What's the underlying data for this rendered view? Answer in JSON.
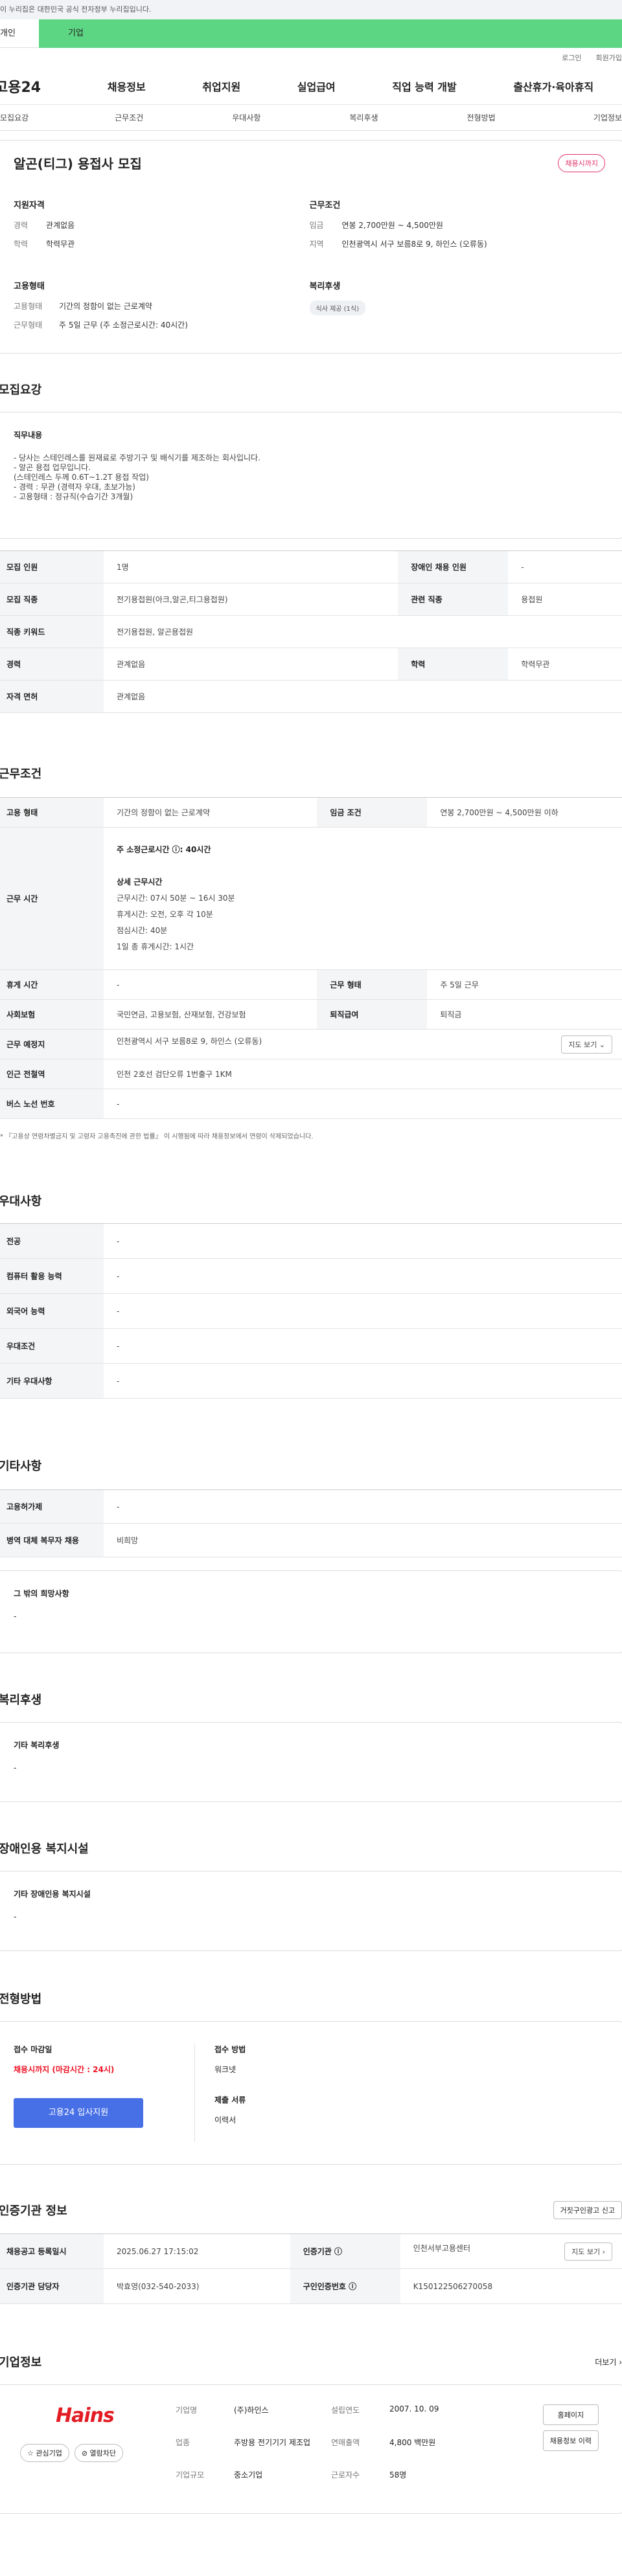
{
  "gov_banner": "이 누리집은 대한민국 공식 전자정부 누리집입니다.",
  "topbar": {
    "t1": "개인",
    "t2": "기업"
  },
  "util": [
    "로그인",
    "회원가입"
  ],
  "logo": "고용24",
  "gnb": [
    "채용정보",
    "취업지원",
    "실업급여",
    "직업 능력 개발",
    "출산휴가·육아휴직"
  ],
  "subtabs": [
    "모집요강",
    "근무조건",
    "우대사항",
    "복리후생",
    "전형방법",
    "기업정보"
  ],
  "summary": {
    "title": "알곤(티그) 용접사 모집",
    "badge": "채용시까지",
    "qual_h": "지원자격",
    "qual": [
      {
        "k": "경력",
        "v": "관계없음"
      },
      {
        "k": "학력",
        "v": "학력무관"
      }
    ],
    "cond_h": "근무조건",
    "cond": [
      {
        "k": "임금",
        "v": "연봉 2,700만원 ~ 4,500만원"
      },
      {
        "k": "지역",
        "v": "인천광역시 서구 보름8로 9, 하인스 (오류동)"
      }
    ],
    "emp_h": "고용형태",
    "emp": [
      {
        "k": "고용형태",
        "v": "기간의 정함이 없는 근로계약"
      },
      {
        "k": "근무형태",
        "v": "주 5일 근무 (주 소정근로시간: 40시간)"
      }
    ],
    "welf_h": "복리후생",
    "welf_chip": "식사 제공 (1식)"
  },
  "recruit": {
    "title": "모집요강",
    "job_h": "직무내용",
    "desc": [
      "- 당사는 스테인레스를 원재료로 주방기구 및 배식기를 제조하는 회사입니다.",
      "- 알곤 용접 업무입니다.",
      "  (스테인레스 두께 0.6T~1.2T 용접 작업)",
      "- 경력 : 무관 (경력자 우대, 초보가능)",
      "- 고용형태 : 정규직(수습기간 3개월)"
    ],
    "rows": [
      [
        "모집 인원",
        "1명",
        "장애인 채용 인원",
        "-"
      ],
      [
        "모집 직종",
        "전기용접원(아크,알곤,티그용접원)",
        "관련 직종",
        "용접원"
      ],
      [
        "직종 키워드",
        "전기용접원, 알곤용접원"
      ],
      [
        "경력",
        "관계없음",
        "학력",
        "학력무관"
      ],
      [
        "자격 면허",
        "관계없음"
      ]
    ]
  },
  "work": {
    "title": "근무조건",
    "r1": [
      "고용 형태",
      "기간의 정함이 없는 근로계약",
      "임금 조건",
      "연봉 2,700만원 ~ 4,500만원 이하"
    ],
    "time_h": "근무 시간",
    "time_main": "주 소정근로시간 ⓘ: 40시간",
    "time_detail": [
      "상세 근무시간",
      "근무시간: 07시 50분 ~ 16시 30분",
      "휴게시간: 오전, 오후 각 10분",
      "점심시간: 40분",
      "1일 총 휴게시간: 1시간"
    ],
    "r3": [
      "휴게 시간",
      "-",
      "근무 형태",
      "주 5일 근무"
    ],
    "r4": [
      "사회보험",
      "국민연금, 고용보험, 산재보험, 건강보험",
      "퇴직급여",
      "퇴직금"
    ],
    "r5": [
      "근무 예정지",
      "인천광역시 서구 보름8로 9, 하인스 (오류동)"
    ],
    "map_btn": "지도 보기 ⌄",
    "r6": [
      "인근 전철역",
      "인천 2호선 검단오류 1번출구 1KM"
    ],
    "r7": [
      "버스 노선 번호",
      "-"
    ],
    "note": "* 『고용상 연령차별금지 및 고령자 고용촉진에 관한 법률』 이 시행됨에 따라 채용정보에서 연령이 삭제되었습니다."
  },
  "pref": {
    "title": "우대사항",
    "rows": [
      [
        "전공",
        "-"
      ],
      [
        "컴퓨터 활용 능력",
        "-"
      ],
      [
        "외국어 능력",
        "-"
      ],
      [
        "우대조건",
        "-"
      ],
      [
        "기타 우대사항",
        "-"
      ]
    ]
  },
  "etc": {
    "title": "기타사항",
    "rows": [
      [
        "고용허가제",
        "-"
      ],
      [
        "병역 대체 복무자 채용",
        "비희망"
      ]
    ],
    "box_h": "그 밖의 희망사항",
    "box_v": "-"
  },
  "welfare": {
    "title": "복리후생",
    "box_h": "기타 복리후생",
    "box_v": "-"
  },
  "disab": {
    "title": "장애인용 복지시설",
    "box_h": "기타 장애인용 복지시설",
    "box_v": "-"
  },
  "screen": {
    "title": "전형방법",
    "deadline_h": "접수 마감일",
    "deadline_v": "채용시까지 (마감시간 : 24시)",
    "apply": "고용24 입사지원",
    "method_h": "접수 방법",
    "method_v": "워크넷",
    "doc_h": "제출 서류",
    "doc_v": "이력서"
  },
  "cert": {
    "title": "인증기관 정보",
    "report": "거짓구인광고 신고",
    "rows": [
      [
        "채용공고 등록일시",
        "2025.06.27 17:15:02",
        "인증기관 ⓘ",
        "인천서부고용센터"
      ],
      [
        "인증기관 담당자",
        "박효영(032-540-2033)",
        "구인인증번호 ⓘ",
        "K150122506270058"
      ]
    ],
    "map_btn": "지도 보기 ›"
  },
  "company": {
    "title": "기업정보",
    "more": "더보기 ›",
    "logo": "Hains",
    "btn1": "☆ 관심기업",
    "btn2": "⊘ 열람차단",
    "info": [
      [
        "기업명",
        "(주)하인스",
        "설립연도",
        "2007. 10. 09"
      ],
      [
        "업종",
        "주방용 전기기기 제조업",
        "연매출액",
        "4,800 백만원"
      ],
      [
        "기업규모",
        "중소기업",
        "근로자수",
        "58명"
      ]
    ],
    "home": "홈페이지",
    "jobs": "채용정보 이력"
  }
}
